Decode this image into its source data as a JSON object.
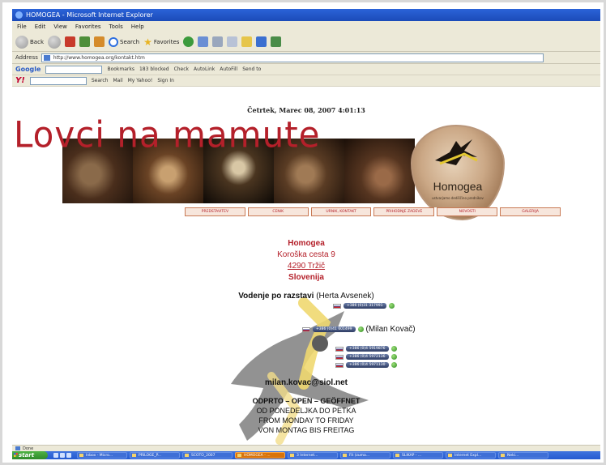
{
  "window": {
    "title": "HOMOGEA - Microsoft Internet Explorer"
  },
  "menu": [
    "File",
    "Edit",
    "View",
    "Favorites",
    "Tools",
    "Help"
  ],
  "toolbar": {
    "back": "Back",
    "search": "Search",
    "favorites": "Favorites"
  },
  "address": {
    "label": "Address",
    "url": "http://www.homogea.org/kontakt.htm"
  },
  "googlebar": {
    "logo": "Google",
    "bookmarks": "Bookmarks",
    "popups": "183 blocked",
    "check": "Check",
    "autolink": "AutoLink",
    "autofill": "AutoFill",
    "send": "Send to"
  },
  "yahoobar": {
    "logo": "Y!",
    "search": "Search",
    "mail": "Mail",
    "myyahoo": "My Yahoo!",
    "signin": "Sign In"
  },
  "page": {
    "datetime": "Četrtek, Marec 08, 2007 4:01:13",
    "banner_title": "Lovci na mamute",
    "logo_name": "Homogea",
    "logo_sub": "ustvarjamo dediščino prednikov",
    "nav": [
      "PREDSTAVITEV",
      "CENIK",
      "URNIK, KONTAKT",
      "PRIHODNJE ZADEVE",
      "NOVOSTI",
      "GALERIJA"
    ],
    "org_name": "Homogea",
    "street": "Koroška cesta 9",
    "city": "4290 Tržič",
    "country": "Slovenija",
    "guided_bold": "Vodenje po razstavi",
    "guided_person": "(Herta Avsenek)",
    "phone_herta": "+386 (0)31 317991",
    "phone_milan": "+386 (0)41 601499",
    "milan_name": "(Milan Kovač)",
    "phones": [
      "+386 (0)4 5919876",
      "+386 (0)4 5972136",
      "+386 (0)4 5971130"
    ],
    "email": "milan.kovac@siol.net",
    "hours_title": "ODPRTO – OPEN – GEÖFFNET",
    "hours_lines": [
      "OD PONEDELJKA DO PETKA",
      "FROM MONDAY TO FRIDAY",
      "VON MONTAG BIS FREITAG"
    ]
  },
  "statusbar": {
    "text": "Done"
  },
  "taskbar": {
    "start": "start",
    "tasks": [
      "Inbox - Micro...",
      "PRILOGE_P...",
      "SCOTO_2007",
      "HOMOGEA - ...",
      "3 Internet...",
      "Fit (zuma...",
      "SLIKAP - ...",
      "Internet Expl...",
      "Neki..."
    ]
  },
  "colors": {
    "brand_red": "#b4202a",
    "xp_blue": "#245ad0",
    "xp_green": "#2f8a2a"
  }
}
